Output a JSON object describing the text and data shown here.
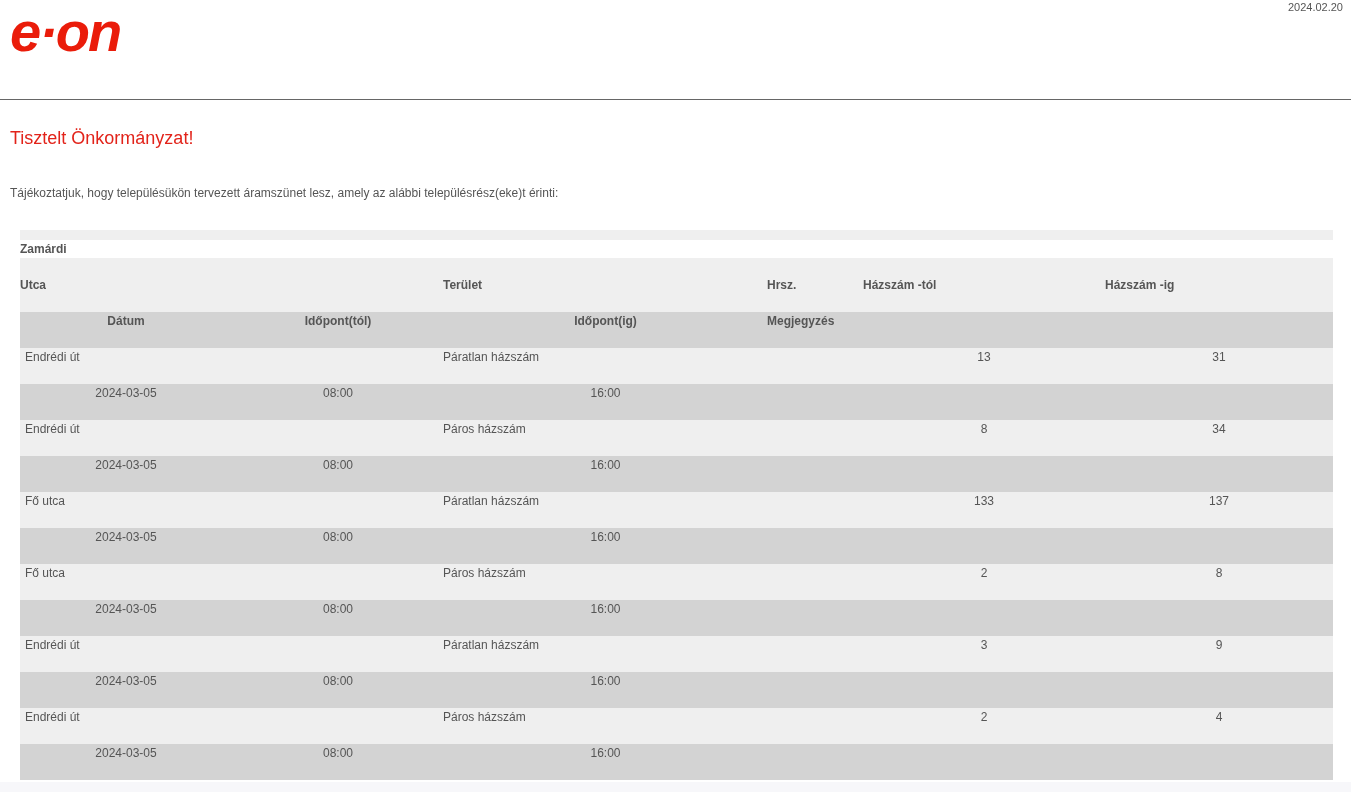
{
  "header": {
    "logo": "e·on",
    "date": "2024.02.20"
  },
  "greeting": "Tisztelt Önkormányzat!",
  "intro": "Tájékoztatjuk, hogy településükön tervezett áramszünet lesz, amely az alábbi településrész(eke)t érinti:",
  "table": {
    "town": "Zamárdi",
    "columns": [
      "Utca",
      "Terület",
      "Hrsz.",
      "Házszám -tól",
      "Házszám -ig"
    ],
    "subcolumns": [
      "Dátum",
      "Időpont(tól)",
      "Időpont(ig)",
      "Megjegyzés"
    ],
    "rows": [
      {
        "street": "Endrédi út",
        "area": "Páratlan házszám",
        "from": "13",
        "to": "31",
        "date": "2024-03-05",
        "time_from": "08:00",
        "time_to": "16:00"
      },
      {
        "street": "Endrédi út",
        "area": "Páros házszám",
        "from": "8",
        "to": "34",
        "date": "2024-03-05",
        "time_from": "08:00",
        "time_to": "16:00"
      },
      {
        "street": "Fő utca",
        "area": "Páratlan házszám",
        "from": "133",
        "to": "137",
        "date": "2024-03-05",
        "time_from": "08:00",
        "time_to": "16:00"
      },
      {
        "street": "Fő utca",
        "area": "Páros házszám",
        "from": "2",
        "to": "8",
        "date": "2024-03-05",
        "time_from": "08:00",
        "time_to": "16:00"
      },
      {
        "street": "Endrédi út",
        "area": "Páratlan házszám",
        "from": "3",
        "to": "9",
        "date": "2024-03-05",
        "time_from": "08:00",
        "time_to": "16:00"
      },
      {
        "street": "Endrédi út",
        "area": "Páros házszám",
        "from": "2",
        "to": "4",
        "date": "2024-03-05",
        "time_from": "08:00",
        "time_to": "16:00"
      }
    ]
  }
}
